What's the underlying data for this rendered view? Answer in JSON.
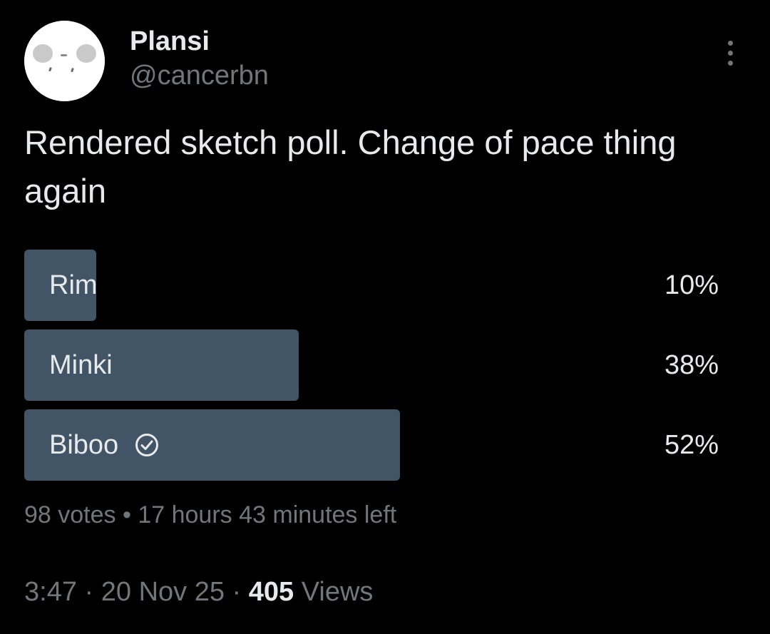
{
  "author": {
    "display_name": "Plansi",
    "handle": "@cancerbn"
  },
  "tweet": {
    "text": "Rendered sketch poll. Change of pace thing again"
  },
  "poll": {
    "options": [
      {
        "label": "Rim",
        "percent_text": "10%",
        "fraction": 0.1,
        "winner": false
      },
      {
        "label": "Minki",
        "percent_text": "38%",
        "fraction": 0.38,
        "winner": false
      },
      {
        "label": "Biboo",
        "percent_text": "52%",
        "fraction": 0.52,
        "winner": true
      }
    ],
    "votes": "98 votes",
    "separator": "•",
    "time_left": "17 hours 43 minutes left"
  },
  "meta": {
    "time": "3:47",
    "dot1": "·",
    "date": "20 Nov 25",
    "dot2": "·",
    "views_count": "405",
    "views_label": "Views"
  },
  "colors": {
    "background": "#000000",
    "primary_text": "#e7e9ea",
    "secondary_text": "#71767b",
    "poll_bar": "#425566"
  },
  "icons": {
    "more": "more-vertical-icon",
    "winner": "check-circle-icon"
  }
}
